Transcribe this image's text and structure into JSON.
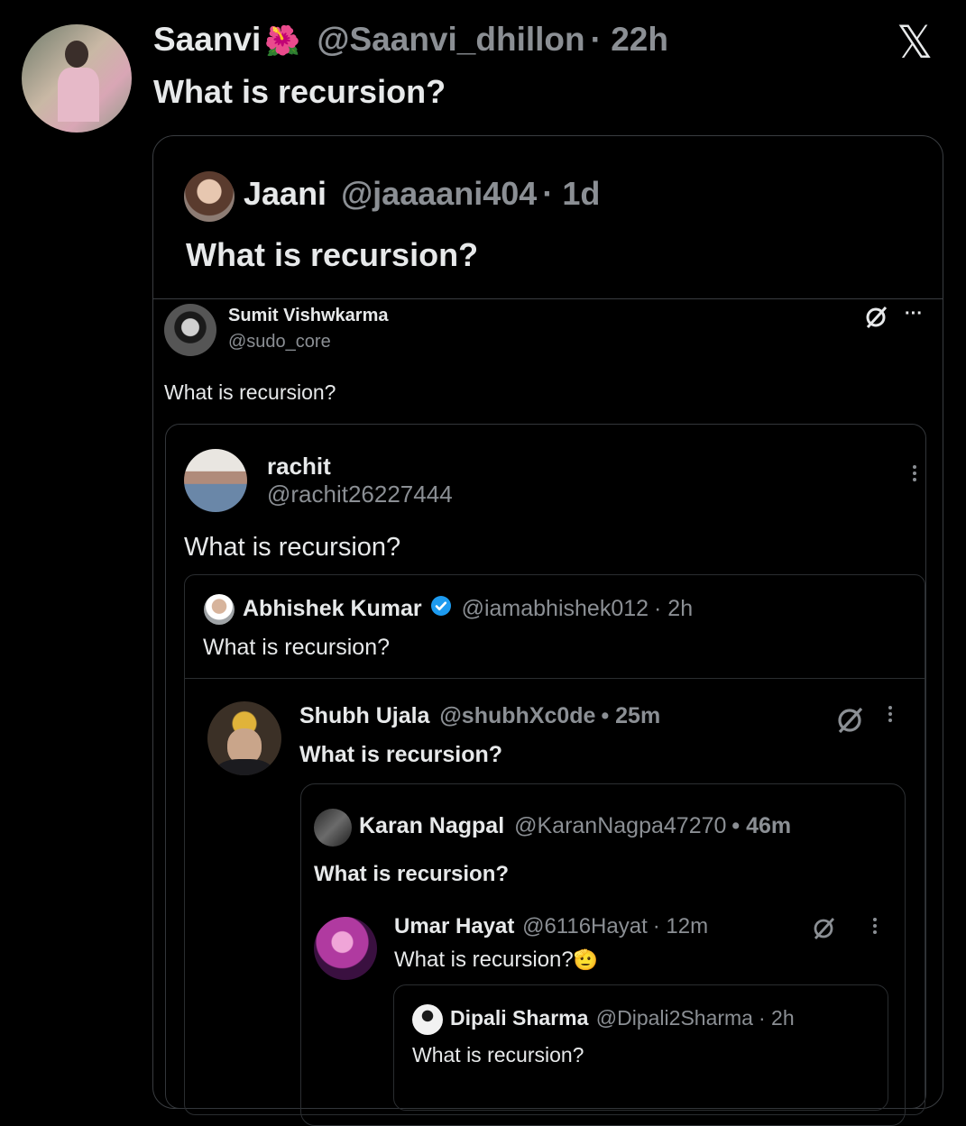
{
  "outer": {
    "name": "Saanvi",
    "emoji": "🌺",
    "handle": "@Saanvi_dhillon",
    "time": "· 22h",
    "text": "What is recursion?"
  },
  "l1": {
    "name": "Jaani",
    "handle": "@jaaaani404",
    "time": "· 1d",
    "text": "What is recursion?"
  },
  "l2": {
    "name": "Sumit Vishwkarma",
    "handle": "@sudo_core",
    "text": "What is recursion?",
    "more": "···"
  },
  "l3": {
    "name": "rachit",
    "handle": "@rachit26227444",
    "text": "What is recursion?"
  },
  "l4": {
    "name": "Abhishek Kumar",
    "handle": "@iamabhishek012",
    "time": "· 2h",
    "text": "What is recursion?"
  },
  "l5": {
    "name": "Shubh Ujala",
    "handle": "@shubhXc0de",
    "time": "• 25m",
    "text": "What is recursion?"
  },
  "l6": {
    "name": "Karan Nagpal",
    "handle": "@KaranNagpa47270",
    "time": "• 46m",
    "text": "What is recursion?"
  },
  "l7": {
    "name": "Umar Hayat",
    "handle": "@6116Hayat",
    "time": "· 12m",
    "text": "What is recursion?",
    "emoji": "🫡"
  },
  "l8": {
    "name": "Dipali Sharma",
    "handle": "@Dipali2Sharma",
    "time": "· 2h",
    "text": "What is recursion?"
  },
  "logo": "𝕏",
  "colors": {
    "background": "#000000",
    "text": "#e7e9ea",
    "muted": "#8b8f94",
    "verified": "#1d9bf0",
    "border": "#2f3336"
  }
}
